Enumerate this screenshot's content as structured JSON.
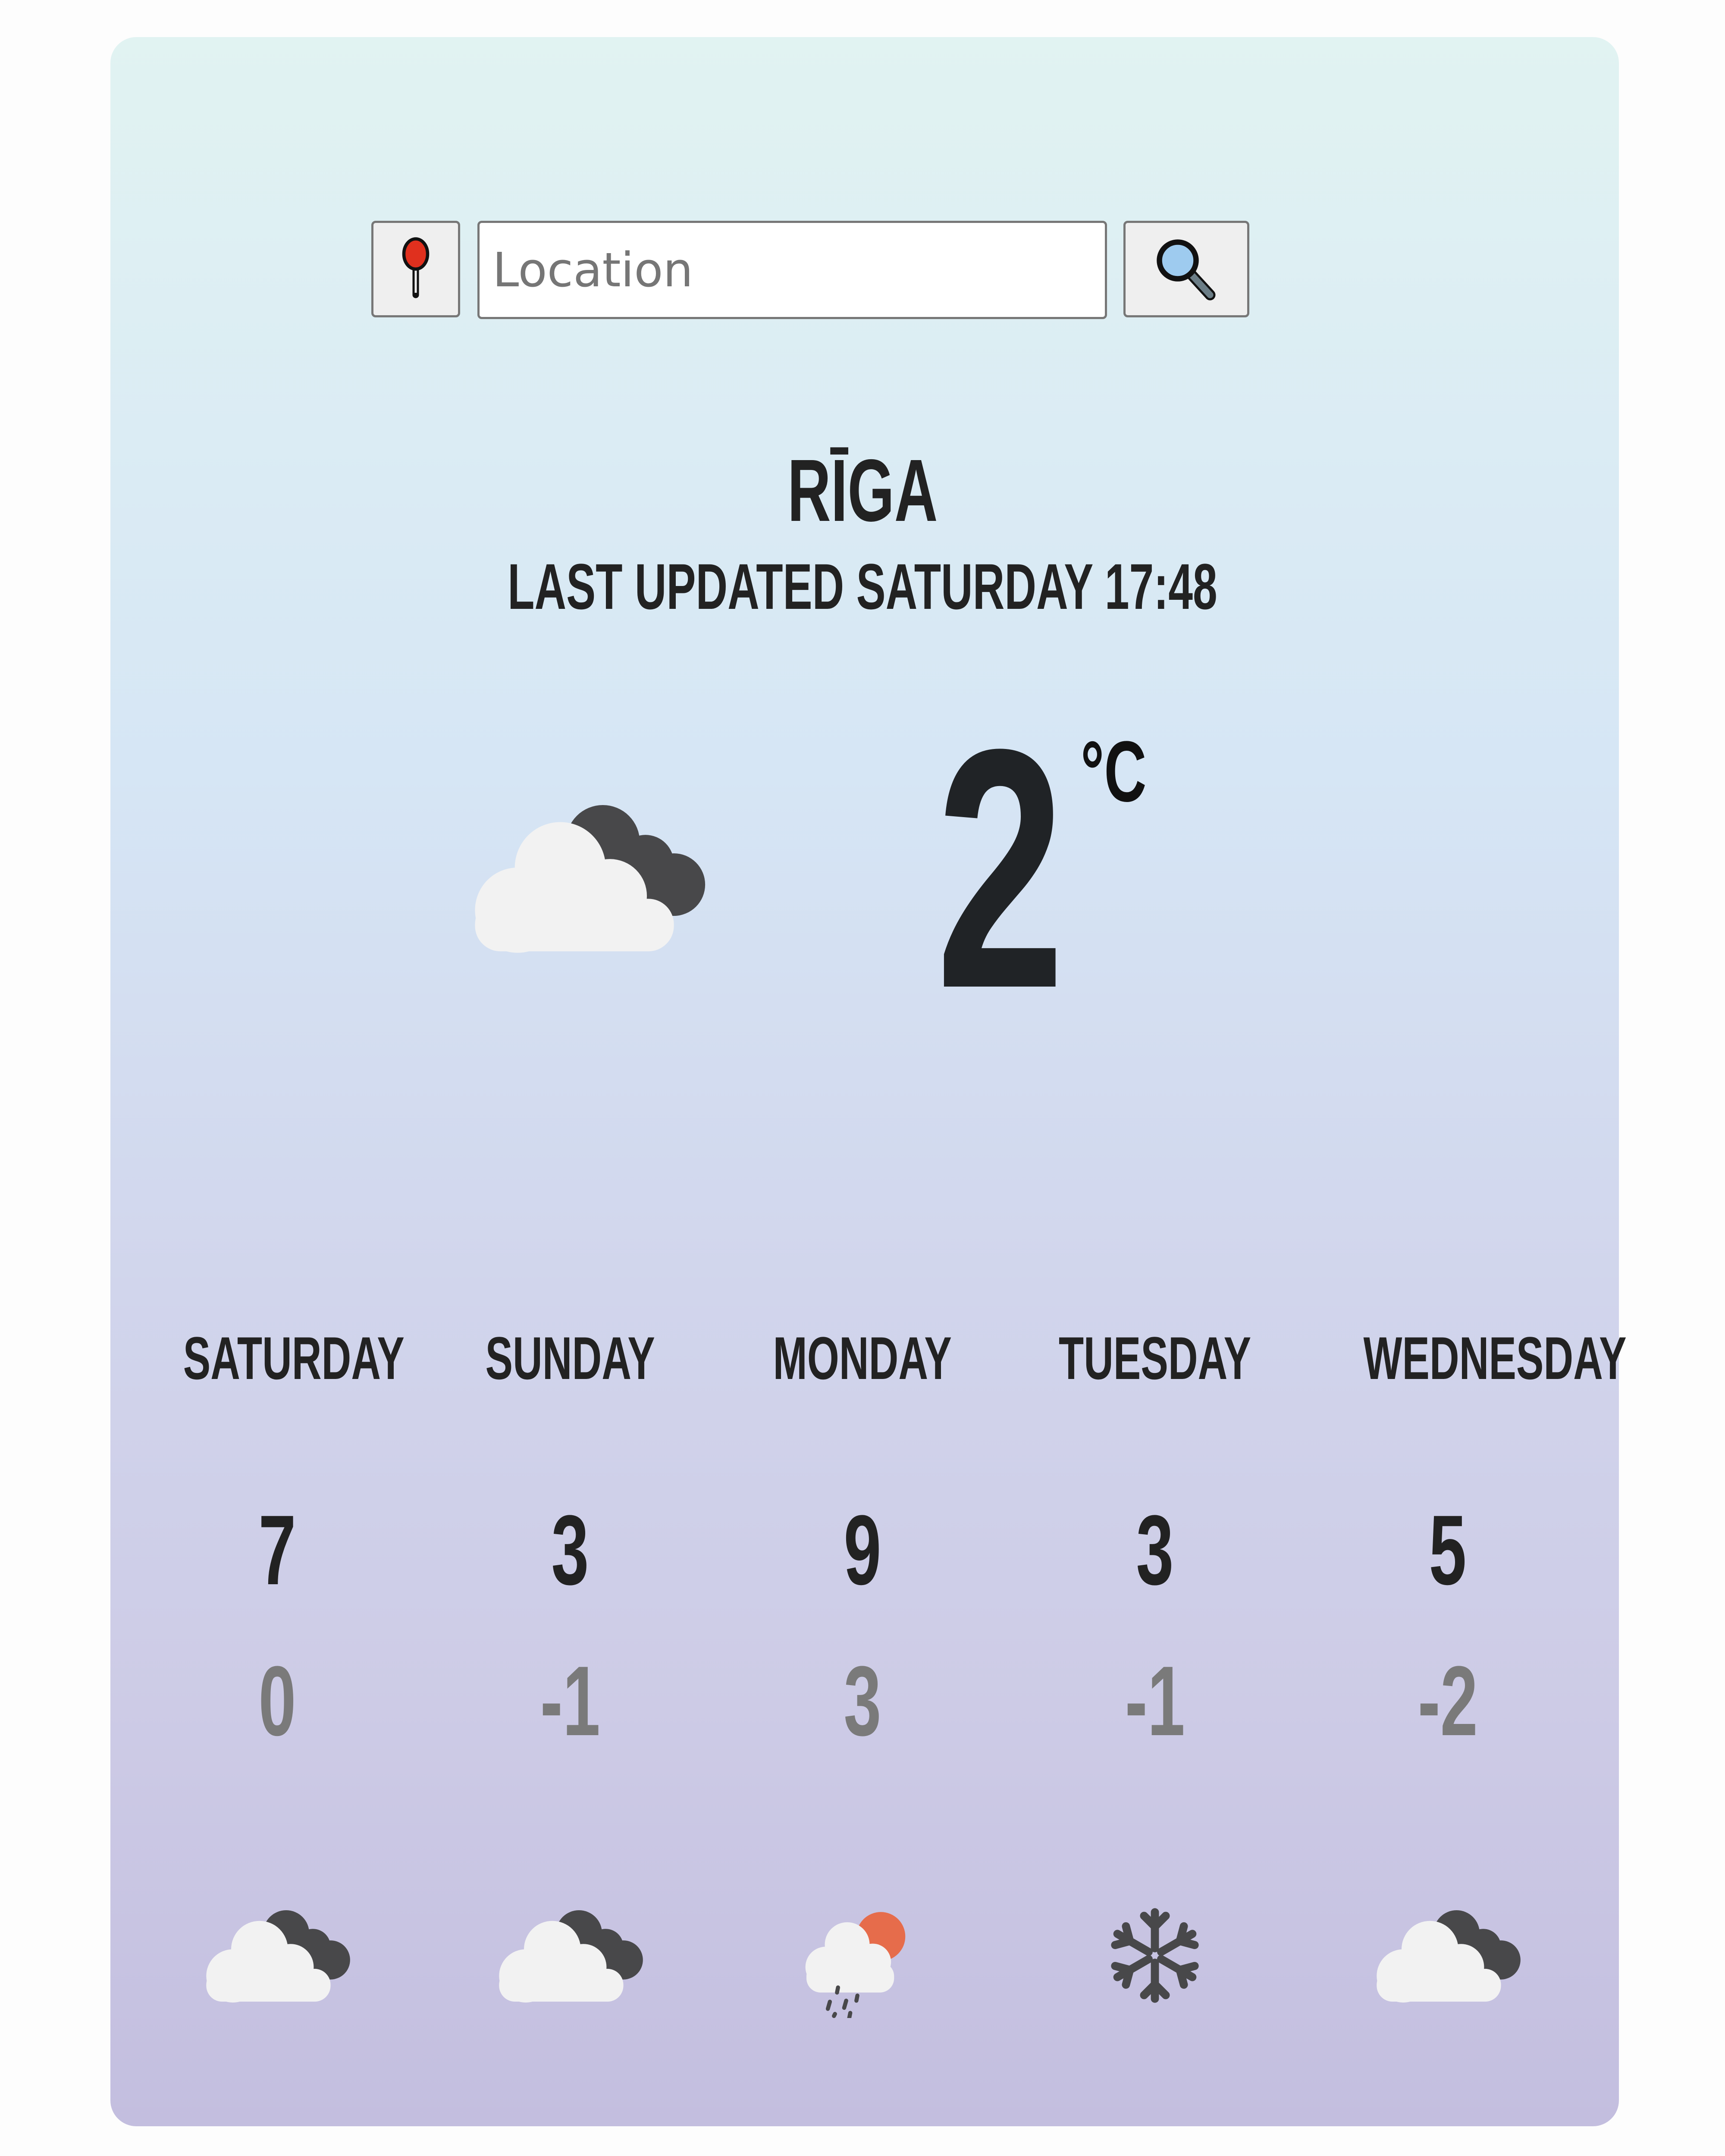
{
  "search": {
    "locate_button_icon": "map-pin-icon",
    "placeholder": "Location",
    "value": "",
    "search_button_icon": "magnifier-icon"
  },
  "current": {
    "city": "RĪGA",
    "last_updated": "LAST UPDATED SATURDAY 17:48",
    "temperature": "2",
    "unit": "°C",
    "condition_icon": "cloudy-icon"
  },
  "forecast": [
    {
      "day": "SATURDAY",
      "high": "7",
      "low": "0",
      "icon": "cloudy-icon"
    },
    {
      "day": "SUNDAY",
      "high": "3",
      "low": "-1",
      "icon": "cloudy-icon"
    },
    {
      "day": "MONDAY",
      "high": "9",
      "low": "3",
      "icon": "sun-cloud-rain-icon"
    },
    {
      "day": "TUESDAY",
      "high": "3",
      "low": "-1",
      "icon": "snowflake-icon"
    },
    {
      "day": "WEDNESDAY",
      "high": "5",
      "low": "-2",
      "icon": "cloudy-icon"
    }
  ],
  "colors": {
    "sun": "#e66c4b",
    "cloud_light": "#f2f2f2",
    "cloud_dark": "#48484a",
    "low_temp": "#7a7a7a"
  }
}
